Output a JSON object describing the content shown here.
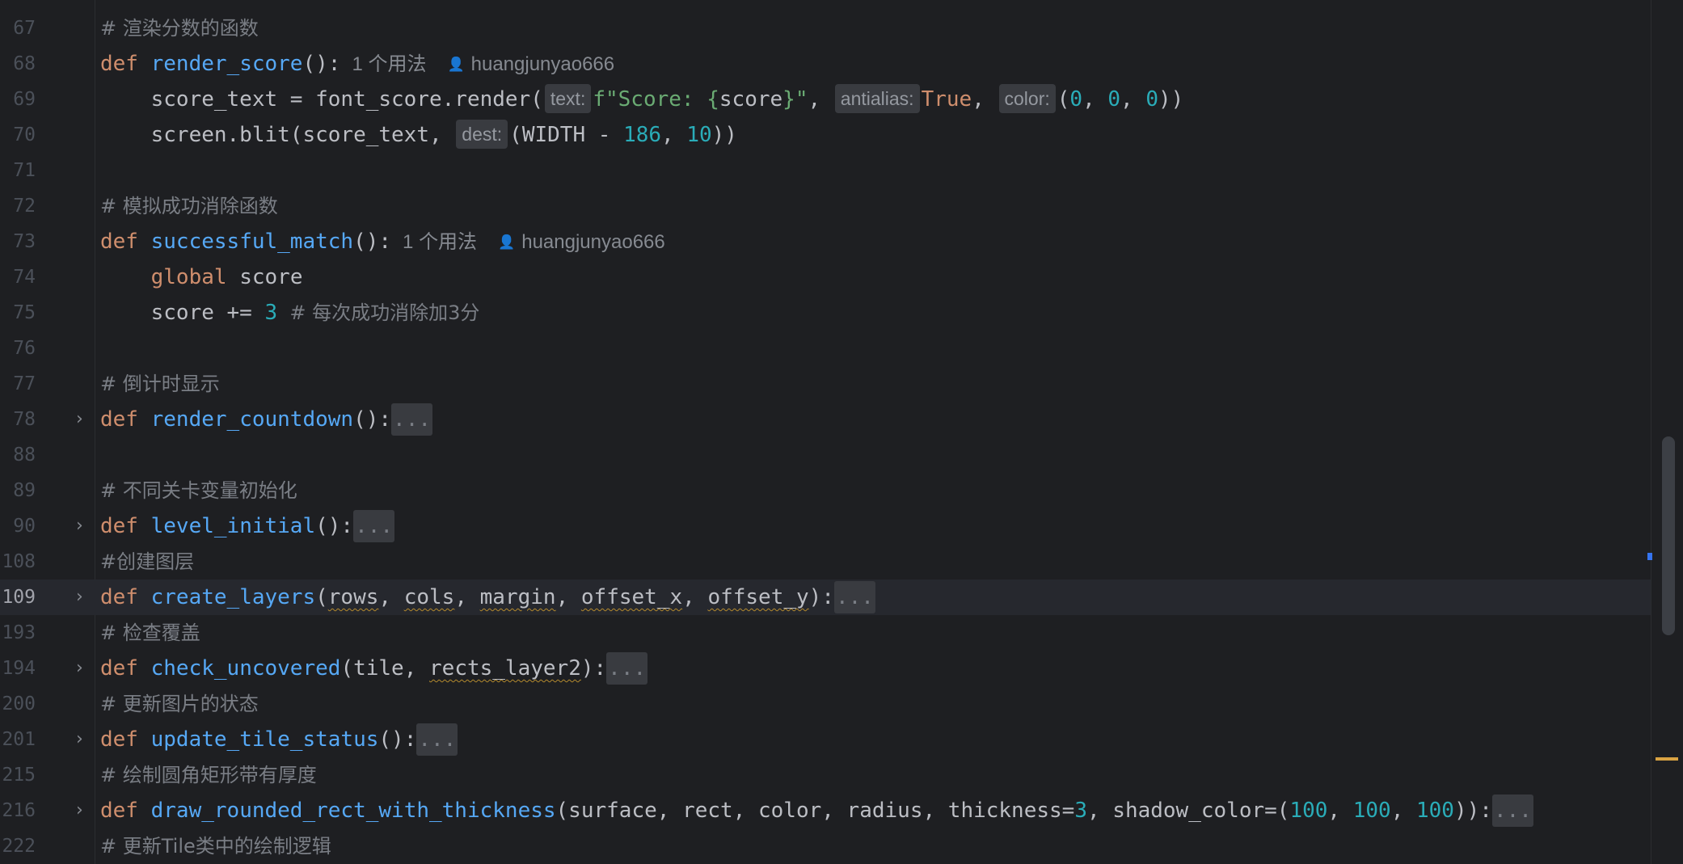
{
  "lines": [
    {
      "no": "67",
      "t1": "# 渲染分数的函数"
    },
    {
      "no": "68",
      "kw": "def ",
      "fn": "render_score",
      "t1": "():",
      "usage": "1 个用法",
      "author": "huangjunyao666"
    },
    {
      "no": "69",
      "t1": "    score_text = font_score.render(",
      "h1": "text:",
      "s1": "f\"Score: {",
      "t2": "score",
      "s2": "}\"",
      "t3": ", ",
      "h2": "antialias:",
      "kw1": "True",
      "t4": ", ",
      "h3": "color:",
      "t5": "(",
      "n1": "0",
      "t6": ", ",
      "n2": "0",
      "t7": ", ",
      "n3": "0",
      "t8": "))"
    },
    {
      "no": "70",
      "t1": "    screen.blit(score_text, ",
      "h1": "dest:",
      "t2": "(WIDTH - ",
      "n1": "186",
      "t3": ", ",
      "n2": "10",
      "t4": "))"
    },
    {
      "no": "71"
    },
    {
      "no": "72",
      "t1": "# 模拟成功消除函数"
    },
    {
      "no": "73",
      "kw": "def ",
      "fn": "successful_match",
      "t1": "():",
      "usage": "1 个用法",
      "author": "huangjunyao666"
    },
    {
      "no": "74",
      "indent": "    ",
      "kw": "global",
      "t1": " score"
    },
    {
      "no": "75",
      "t1": "    score += ",
      "n1": "3",
      "c1": "  # 每次成功消除加3分"
    },
    {
      "no": "76"
    },
    {
      "no": "77",
      "t1": "# 倒计时显示"
    },
    {
      "no": "78",
      "kw": "def ",
      "fn": "render_countdown",
      "t1": "():",
      "dots": "..."
    },
    {
      "no": "88"
    },
    {
      "no": "89",
      "t1": "# 不同关卡变量初始化"
    },
    {
      "no": "90",
      "kw": "def ",
      "fn": "level_initial",
      "t1": "():",
      "dots": "..."
    },
    {
      "no": "108",
      "t1": "#创建图层"
    },
    {
      "no": "109",
      "kw": "def ",
      "fn": "create_layers",
      "t1": "(",
      "p1": "rows",
      "t2": ", ",
      "p2": "cols",
      "t3": ", ",
      "p3": "margin",
      "t4": ", ",
      "p4": "offset_x",
      "t5": ", ",
      "p5": "offset_y",
      "t6": "):",
      "dots": "..."
    },
    {
      "no": "193",
      "t1": "# 检查覆盖"
    },
    {
      "no": "194",
      "kw": "def ",
      "fn": "check_uncovered",
      "t1": "(tile, ",
      "p1": "rects_layer2",
      "t2": "):",
      "dots": "..."
    },
    {
      "no": "200",
      "t1": "# 更新图片的状态"
    },
    {
      "no": "201",
      "kw": "def ",
      "fn": "update_tile_status",
      "t1": "():",
      "dots": "..."
    },
    {
      "no": "215",
      "t1": "# 绘制圆角矩形带有厚度"
    },
    {
      "no": "216",
      "kw": "def ",
      "fn": "draw_rounded_rect_with_thickness",
      "t1": "(surface, rect, color, radius, thickness=",
      "n1": "3",
      "t2": ", shadow_color=(",
      "n2": "100",
      "t3": ", ",
      "n3": "100",
      "t4": ", ",
      "n4": "100",
      "t5": ")):",
      "dots": "..."
    },
    {
      "no": "222",
      "t1": "# 更新Tile类中的绘制逻辑"
    }
  ],
  "icons": {
    "fold": "chevron-right-icon",
    "author": "user-icon"
  },
  "colors": {
    "background": "#1e1f22",
    "keyword": "#cf8e6d",
    "function": "#56a8f5",
    "number": "#2aacb8",
    "string": "#6aab73",
    "comment": "#7a7e85"
  }
}
